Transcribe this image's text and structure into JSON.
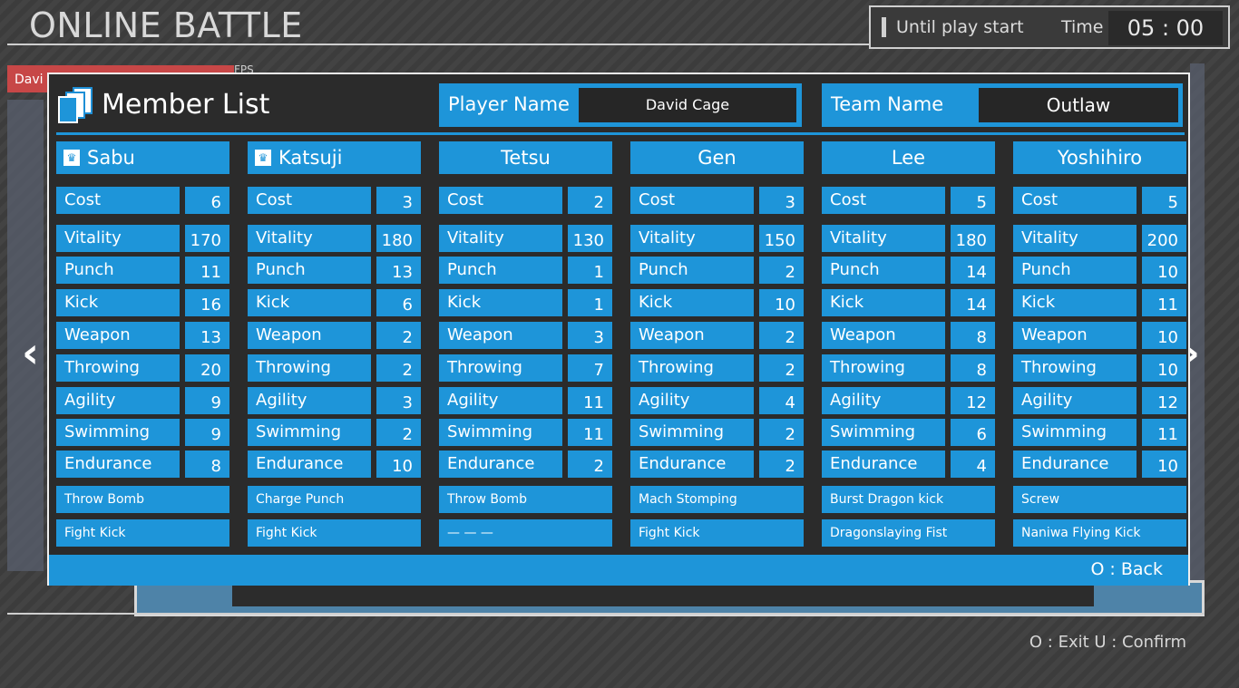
{
  "screen": {
    "title": "ONLINE BATTLE"
  },
  "timer": {
    "label": "Until play start",
    "time_label": "Time",
    "time_value": "05 : 00"
  },
  "background": {
    "player_tag": "Davi",
    "fps_label": "FPS"
  },
  "modal": {
    "title": "Member List",
    "player_name_label": "Player Name",
    "player_name_value": "David Cage",
    "team_name_label": "Team Name",
    "team_name_value": "Outlaw",
    "back_hint": "O : Back"
  },
  "stat_labels": [
    "Cost",
    "Vitality",
    "Punch",
    "Kick",
    "Weapon",
    "Throwing",
    "Agility",
    "Swimming",
    "Endurance"
  ],
  "members": [
    {
      "name": "Sabu",
      "leader": true,
      "stats": [
        "6",
        "170",
        "11",
        "16",
        "13",
        "20",
        "9",
        "9",
        "8"
      ],
      "skills": [
        "Throw Bomb",
        "Fight Kick"
      ]
    },
    {
      "name": "Katsuji",
      "leader": true,
      "stats": [
        "3",
        "180",
        "13",
        "6",
        "2",
        "2",
        "3",
        "2",
        "10"
      ],
      "skills": [
        "Charge Punch",
        "Fight Kick"
      ]
    },
    {
      "name": "Tetsu",
      "leader": false,
      "stats": [
        "2",
        "130",
        "1",
        "1",
        "3",
        "7",
        "11",
        "11",
        "2"
      ],
      "skills": [
        "Throw Bomb",
        "— — —"
      ]
    },
    {
      "name": "Gen",
      "leader": false,
      "stats": [
        "3",
        "150",
        "2",
        "10",
        "2",
        "2",
        "4",
        "2",
        "2"
      ],
      "skills": [
        "Mach Stomping",
        "Fight Kick"
      ]
    },
    {
      "name": "Lee",
      "leader": false,
      "stats": [
        "5",
        "180",
        "14",
        "14",
        "8",
        "8",
        "12",
        "6",
        "4"
      ],
      "skills": [
        "Burst Dragon kick",
        "Dragonslaying Fist"
      ]
    },
    {
      "name": "Yoshihiro",
      "leader": false,
      "stats": [
        "5",
        "200",
        "10",
        "11",
        "10",
        "10",
        "12",
        "11",
        "10"
      ],
      "skills": [
        "Screw",
        "Naniwa Flying Kick"
      ]
    }
  ],
  "footer": {
    "hint": "O : Exit  U : Confirm"
  },
  "colors": {
    "accent": "#1e95d9",
    "panel": "#2b2b2b",
    "background": "#3f3f3f"
  },
  "icons": {
    "crown": "crown-icon",
    "list": "member-list-icon",
    "prev": "chevron-left-icon",
    "next": "chevron-right-icon"
  }
}
